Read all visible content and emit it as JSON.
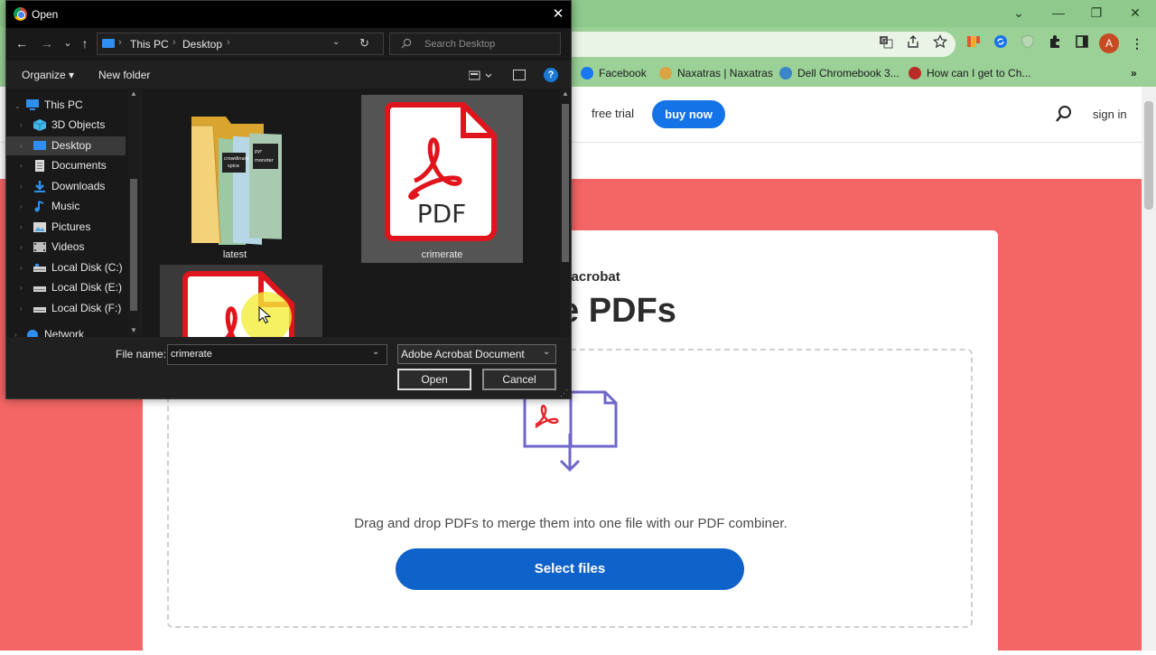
{
  "browser": {
    "window_controls": {
      "minimize": "—",
      "restore": "❐",
      "close": "✕",
      "collapse": "⌄"
    },
    "bookmarks": [
      {
        "label": "Facebook",
        "color": "#1877f2"
      },
      {
        "label": "Naxatras | Naxatras",
        "color": "#d9a441"
      },
      {
        "label": "Dell Chromebook 3...",
        "color": "#3a86c8"
      },
      {
        "label": "How can I get to Ch...",
        "color": "#b92b27"
      }
    ],
    "bookmarks_more": "»",
    "profile_initial": "A",
    "menu_glyph": "⋮"
  },
  "adobe": {
    "header": {
      "free_trial": "free trial",
      "buy_now": "buy now",
      "sign_in": "sign in"
    },
    "kicker": "e acrobat",
    "title": "e PDFs",
    "drop_text": "Drag and drop PDFs to merge them into one file with our PDF combiner.",
    "select_files": "Select files",
    "colors": {
      "hero": "#f46565",
      "primary": "#0f62c9",
      "buy_now": "#1473e6"
    }
  },
  "dialog": {
    "title": "Open",
    "close_glyph": "✕",
    "nav": {
      "back": "←",
      "forward": "→",
      "recent": "⌄",
      "up": "↑"
    },
    "breadcrumbs": [
      "This PC",
      "Desktop"
    ],
    "search_placeholder": "Search Desktop",
    "organize": "Organize ▾",
    "new_folder": "New folder",
    "help": "?",
    "tree": [
      {
        "label": "This PC",
        "icon": "pc-icon",
        "color": "#2f8ff0"
      },
      {
        "label": "3D Objects",
        "icon": "cube-icon",
        "color": "#46b5e8"
      },
      {
        "label": "Desktop",
        "icon": "desktop-icon",
        "color": "#2f8ff0"
      },
      {
        "label": "Documents",
        "icon": "document-icon",
        "color": "#cfcfcf"
      },
      {
        "label": "Downloads",
        "icon": "download-icon",
        "color": "#2f8ff0"
      },
      {
        "label": "Music",
        "icon": "music-icon",
        "color": "#2f8ff0"
      },
      {
        "label": "Pictures",
        "icon": "pictures-icon",
        "color": "#cfcfcf"
      },
      {
        "label": "Videos",
        "icon": "videos-icon",
        "color": "#cfcfcf"
      },
      {
        "label": "Local Disk (C:)",
        "icon": "drive-icon",
        "color": "#cfcfcf"
      },
      {
        "label": "Local Disk (E:)",
        "icon": "drive-icon",
        "color": "#cfcfcf"
      },
      {
        "label": "Local Disk (F:)",
        "icon": "drive-icon",
        "color": "#cfcfcf"
      },
      {
        "label": "Network",
        "icon": "network-icon",
        "color": "#2f8ff0"
      }
    ],
    "files": [
      {
        "label": "latest",
        "type": "folder"
      },
      {
        "label": "crimerate",
        "type": "pdf"
      },
      {
        "label": "",
        "type": "pdf"
      }
    ],
    "pdf_badge": "PDF",
    "folder_thumb_text": [
      "crowdinary",
      "spice",
      "pyr",
      "monster"
    ],
    "file_name_label": "File name:",
    "file_name_value": "crimerate",
    "file_type_value": "Adobe Acrobat Document",
    "open_button": "Open",
    "cancel_button": "Cancel"
  }
}
